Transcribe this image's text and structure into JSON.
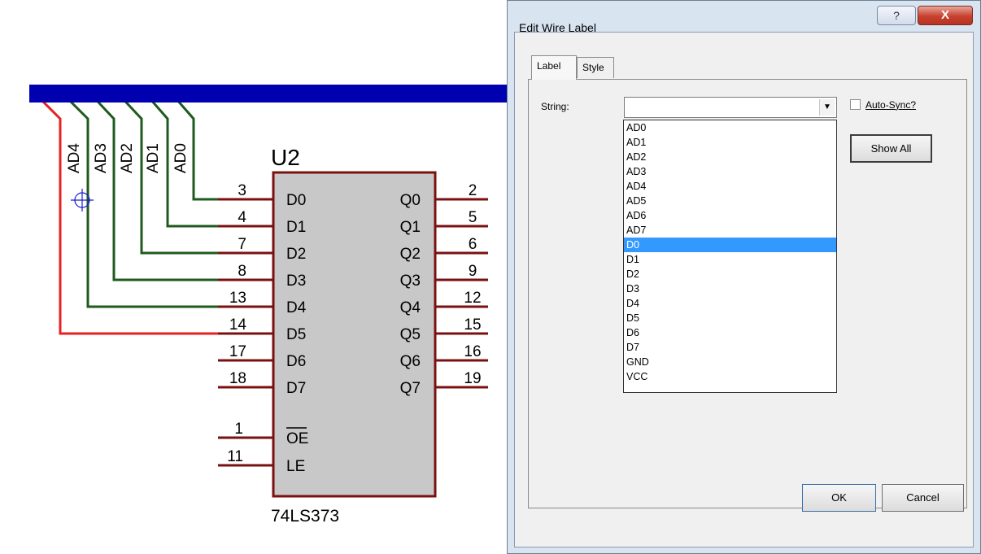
{
  "schematic": {
    "part_ref": "U2",
    "part_value": "74LS373",
    "bus_labels": [
      "AD4",
      "AD3",
      "AD2",
      "AD1",
      "AD0"
    ],
    "left_pins": [
      {
        "num": "3",
        "name": "D0"
      },
      {
        "num": "4",
        "name": "D1"
      },
      {
        "num": "7",
        "name": "D2"
      },
      {
        "num": "8",
        "name": "D3"
      },
      {
        "num": "13",
        "name": "D4"
      },
      {
        "num": "14",
        "name": "D5"
      },
      {
        "num": "17",
        "name": "D6"
      },
      {
        "num": "18",
        "name": "D7"
      }
    ],
    "right_pins": [
      {
        "num": "2",
        "name": "Q0"
      },
      {
        "num": "5",
        "name": "Q1"
      },
      {
        "num": "6",
        "name": "Q2"
      },
      {
        "num": "9",
        "name": "Q3"
      },
      {
        "num": "12",
        "name": "Q4"
      },
      {
        "num": "15",
        "name": "Q5"
      },
      {
        "num": "16",
        "name": "Q6"
      },
      {
        "num": "19",
        "name": "Q7"
      }
    ],
    "control_pins": [
      {
        "num": "1",
        "name": "OE",
        "overline": true
      },
      {
        "num": "11",
        "name": "LE",
        "overline": false
      }
    ],
    "colors": {
      "bus": "#0000b0",
      "wire": "#1f5a1f",
      "selected_wire": "#e82020",
      "pin": "#7a1010",
      "body": "#c8c8c8"
    }
  },
  "dialog": {
    "title": "Edit Wire Label",
    "help_glyph": "?",
    "close_glyph": "X",
    "tabs": [
      {
        "label": "Label",
        "active": true
      },
      {
        "label": "Style",
        "active": false
      }
    ],
    "string_label": "String:",
    "string_value": "",
    "autosync_label": "Auto-Sync?",
    "autosync_checked": false,
    "show_all_label": "Show All",
    "ok_label": "OK",
    "cancel_label": "Cancel",
    "options": [
      "AD0",
      "AD1",
      "AD2",
      "AD3",
      "AD4",
      "AD5",
      "AD6",
      "AD7",
      "D0",
      "D1",
      "D2",
      "D3",
      "D4",
      "D5",
      "D6",
      "D7",
      "GND",
      "VCC"
    ],
    "selected_option": "D0"
  }
}
